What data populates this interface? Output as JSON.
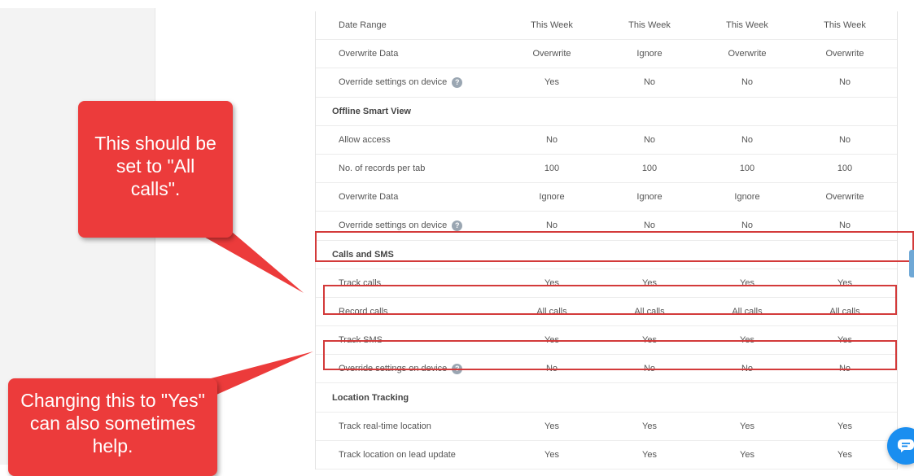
{
  "table": {
    "rows": [
      {
        "type": "setting",
        "label": "Date Range",
        "help": false,
        "values": [
          "This Week",
          "This Week",
          "This Week",
          "This Week"
        ]
      },
      {
        "type": "setting",
        "label": "Overwrite Data",
        "help": false,
        "values": [
          "Overwrite",
          "Ignore",
          "Overwrite",
          "Overwrite"
        ]
      },
      {
        "type": "setting",
        "label": "Override settings on device",
        "help": true,
        "values": [
          "Yes",
          "No",
          "No",
          "No"
        ]
      },
      {
        "type": "section",
        "label": "Offline Smart View"
      },
      {
        "type": "setting",
        "label": "Allow access",
        "help": false,
        "values": [
          "No",
          "No",
          "No",
          "No"
        ]
      },
      {
        "type": "setting",
        "label": "No. of records per tab",
        "help": false,
        "values": [
          "100",
          "100",
          "100",
          "100"
        ]
      },
      {
        "type": "setting",
        "label": "Overwrite Data",
        "help": false,
        "values": [
          "Ignore",
          "Ignore",
          "Ignore",
          "Overwrite"
        ]
      },
      {
        "type": "setting",
        "label": "Override settings on device",
        "help": true,
        "values": [
          "No",
          "No",
          "No",
          "No"
        ]
      },
      {
        "type": "section",
        "label": "Calls and SMS"
      },
      {
        "type": "setting",
        "label": "Track calls",
        "help": false,
        "values": [
          "Yes",
          "Yes",
          "Yes",
          "Yes"
        ]
      },
      {
        "type": "setting",
        "label": "Record calls",
        "help": false,
        "values": [
          "All calls",
          "All calls",
          "All calls",
          "All calls"
        ]
      },
      {
        "type": "setting",
        "label": "Track SMS",
        "help": false,
        "values": [
          "Yes",
          "Yes",
          "Yes",
          "Yes"
        ]
      },
      {
        "type": "setting",
        "label": "Override settings on device",
        "help": true,
        "values": [
          "No",
          "No",
          "No",
          "No"
        ]
      },
      {
        "type": "section",
        "label": "Location Tracking"
      },
      {
        "type": "setting",
        "label": "Track real-time location",
        "help": false,
        "values": [
          "Yes",
          "Yes",
          "Yes",
          "Yes"
        ]
      },
      {
        "type": "setting",
        "label": "Track location on lead update",
        "help": false,
        "values": [
          "Yes",
          "Yes",
          "Yes",
          "Yes"
        ]
      }
    ],
    "help_glyph": "?"
  },
  "callouts": {
    "top": "This should be set to \"All calls\".",
    "bottom": "Changing this to \"Yes\" can also sometimes help."
  },
  "colors": {
    "callout": "#ec3b3b",
    "highlight": "#d33a3a",
    "chat_button": "#1a8ef0"
  },
  "icons": {
    "help": "question-circle-icon",
    "chat": "chat-bubble-icon"
  }
}
